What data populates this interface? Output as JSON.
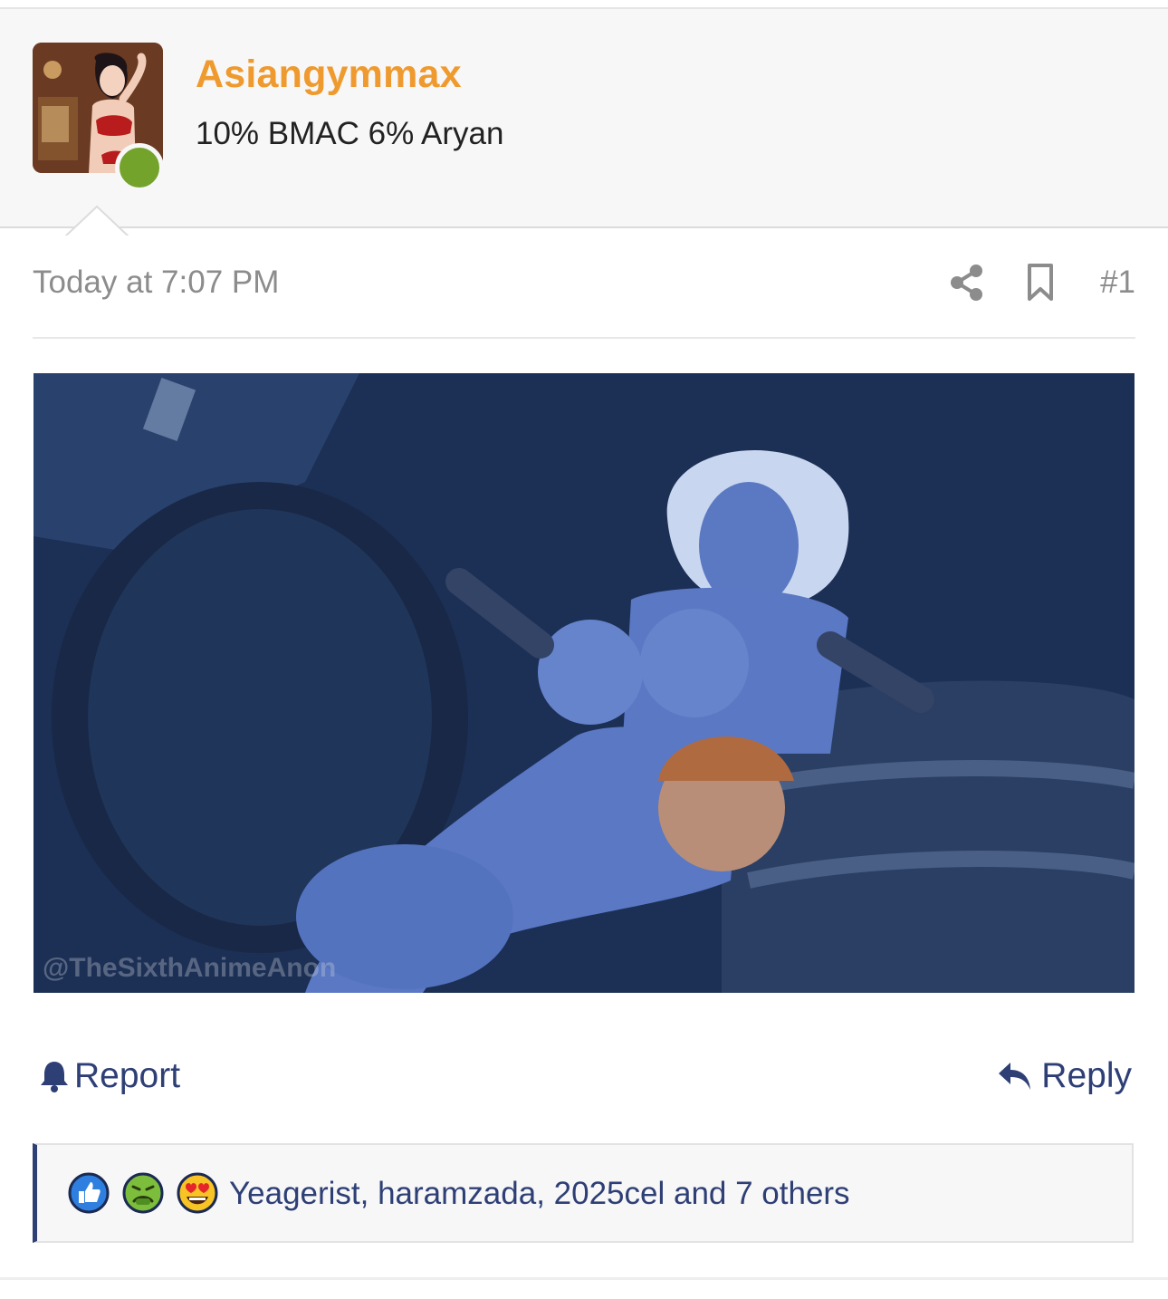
{
  "user": {
    "name": "Asiangymmax",
    "title": "10% BMAC 6% Aryan",
    "online": true
  },
  "post": {
    "date": "Today at 7:07 PM",
    "number": "#1",
    "media_watermark": "@TheSixthAnimeAnon"
  },
  "actions": {
    "report_label": "Report",
    "reply_label": "Reply"
  },
  "reactions": {
    "icons": [
      "like-icon",
      "sick-face-icon",
      "heart-eyes-icon"
    ],
    "summary": "Yeagerist, haramzada, 2025cel and 7 others"
  },
  "colors": {
    "username": "#ef9a2e",
    "link": "#2e3f76",
    "online": "#74a32b",
    "muted": "#8c8c8c"
  }
}
